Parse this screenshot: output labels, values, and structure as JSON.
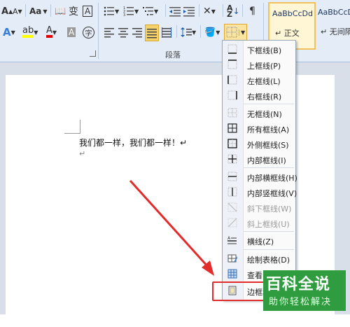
{
  "ribbon": {
    "font_size_grow": "A",
    "font_size_shrink": "A",
    "change_case": "Aa",
    "pinyin": "变",
    "char_border": "A",
    "char_shading": "A",
    "font_color_a": "A",
    "enclose_char": "字",
    "paragraph_group_label": "段落",
    "style_normal_sample": "AaBbCcDd",
    "style_normal_name": "正文",
    "style_nospacing_sample": "AaBbCcDd",
    "style_nospacing_name": "无间隔"
  },
  "document": {
    "line1": "我们都一样，我们都一样！↵",
    "line2": "↵"
  },
  "border_menu": {
    "items": [
      {
        "label": "下框线(B)",
        "icon": "bottom-border-icon",
        "disabled": false
      },
      {
        "label": "上框线(P)",
        "icon": "top-border-icon",
        "disabled": false
      },
      {
        "label": "左框线(L)",
        "icon": "left-border-icon",
        "disabled": false
      },
      {
        "label": "右框线(R)",
        "icon": "right-border-icon",
        "disabled": false
      },
      {
        "label": "无框线(N)",
        "icon": "no-border-icon",
        "disabled": false
      },
      {
        "label": "所有框线(A)",
        "icon": "all-borders-icon",
        "disabled": false
      },
      {
        "label": "外侧框线(S)",
        "icon": "outside-borders-icon",
        "disabled": false
      },
      {
        "label": "内部框线(I)",
        "icon": "inside-borders-icon",
        "disabled": false
      },
      {
        "label": "内部横框线(H)",
        "icon": "inside-horizontal-border-icon",
        "disabled": false
      },
      {
        "label": "内部竖框线(V)",
        "icon": "inside-vertical-border-icon",
        "disabled": false
      },
      {
        "label": "斜下框线(W)",
        "icon": "diagonal-down-border-icon",
        "disabled": true
      },
      {
        "label": "斜上框线(U)",
        "icon": "diagonal-up-border-icon",
        "disabled": true
      },
      {
        "label": "横线(Z)",
        "icon": "horizontal-line-icon",
        "disabled": false
      },
      {
        "label": "绘制表格(D)",
        "icon": "draw-table-icon",
        "disabled": false
      },
      {
        "label": "查看网格线(G)",
        "icon": "view-gridlines-icon",
        "disabled": false
      },
      {
        "label": "边框和底纹(O)...",
        "icon": "borders-shading-icon",
        "disabled": false
      }
    ]
  },
  "watermark": {
    "title": "百科全说",
    "subtitle": "助你轻松解决"
  },
  "colors": {
    "ribbon_bg": "#e4ecf7",
    "arrow": "#e32b2b",
    "highlight_box": "#e32b2b",
    "watermark_bg": "#2f9d3f"
  }
}
